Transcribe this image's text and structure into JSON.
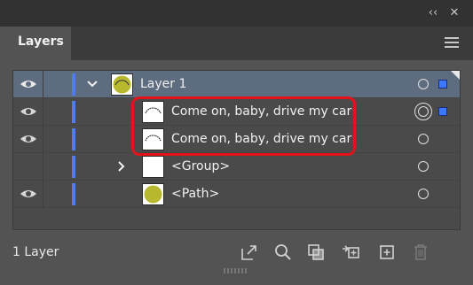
{
  "panel": {
    "tab_title": "Layers",
    "collapse_glyph": "‹‹",
    "close_glyph": "✕"
  },
  "rows": [
    {
      "label": "Layer 1",
      "visible": true,
      "selected": true,
      "expanded": true,
      "thumb": "layer-circle-olive",
      "target": "single"
    },
    {
      "label": "Come on, baby, drive my car",
      "visible": true,
      "selected": false,
      "thumb": "arc-text",
      "target": "double"
    },
    {
      "label": "Come on, baby, drive my car",
      "visible": true,
      "selected": false,
      "thumb": "arc-text",
      "target": "single"
    },
    {
      "label": "<Group>",
      "visible": false,
      "selected": false,
      "collapsed": true,
      "thumb": "blank",
      "target": "single"
    },
    {
      "label": "<Path>",
      "visible": true,
      "selected": false,
      "thumb": "olive-circle",
      "target": "single"
    }
  ],
  "footer": {
    "layer_count": "1 Layer",
    "icons": [
      "export-icon",
      "search-icon",
      "clipping-mask-icon",
      "move-to-layer-icon",
      "new-layer-icon",
      "trash-icon"
    ]
  },
  "colors": {
    "layer_color": "#4f7bf4",
    "selection_fill": "#5e6c80",
    "thumb_olive": "#b8b82f",
    "highlight_box": "#e4131a"
  }
}
